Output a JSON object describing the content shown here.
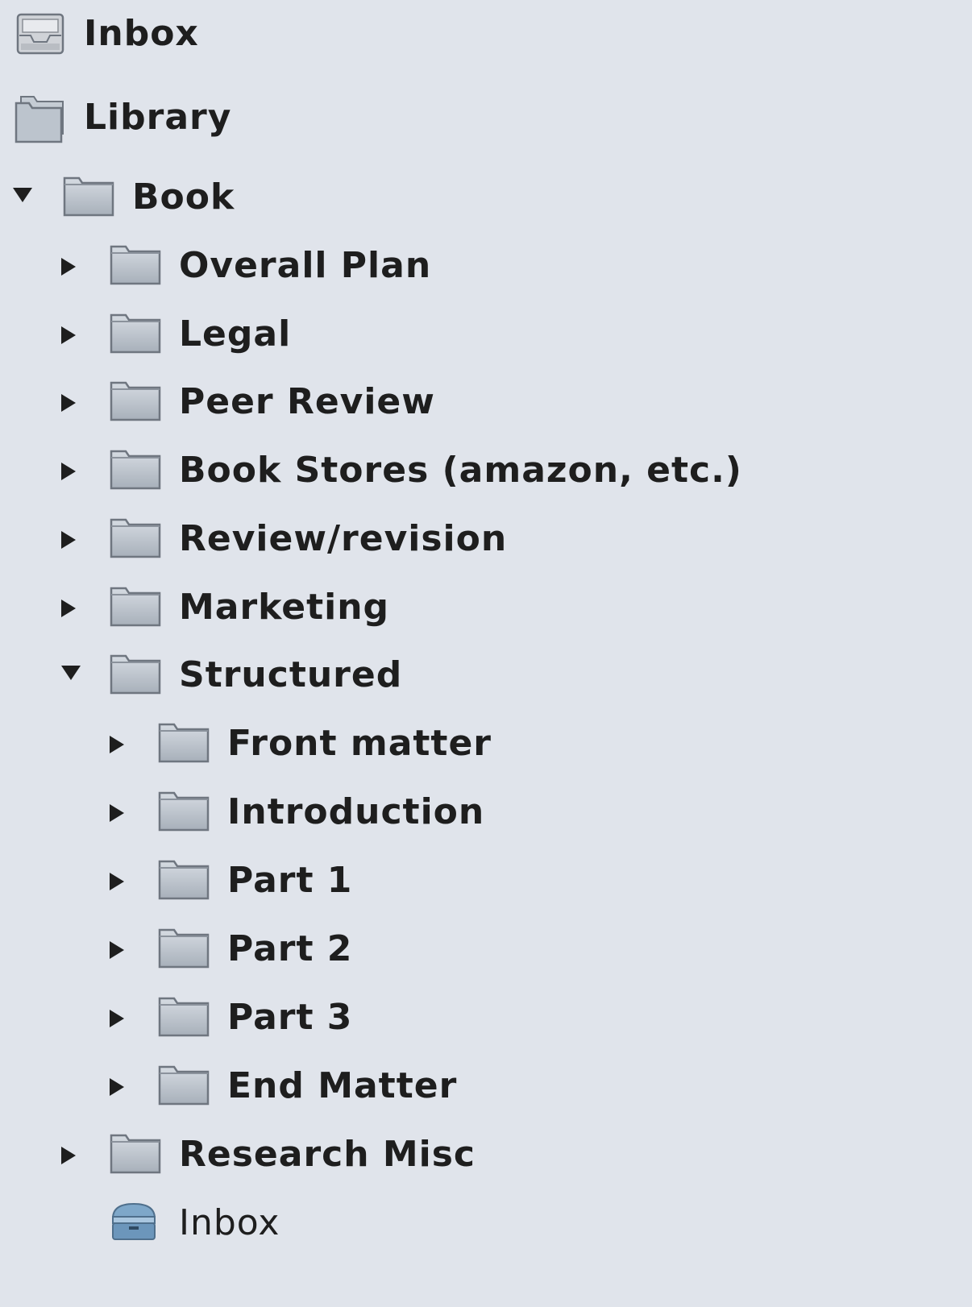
{
  "tree": {
    "items": [
      {
        "label": "Inbox",
        "icon": "inbox-tray-icon",
        "level": 0,
        "expander": "none"
      },
      {
        "label": "Library",
        "icon": "library-folders-icon",
        "level": 0,
        "expander": "none"
      },
      {
        "label": "Book",
        "icon": "folder-icon",
        "level": 1,
        "expander": "expanded"
      },
      {
        "label": "Overall Plan",
        "icon": "folder-icon",
        "level": 2,
        "expander": "collapsed"
      },
      {
        "label": "Legal",
        "icon": "folder-icon",
        "level": 2,
        "expander": "collapsed"
      },
      {
        "label": "Peer Review",
        "icon": "folder-icon",
        "level": 2,
        "expander": "collapsed"
      },
      {
        "label": "Book Stores (amazon, etc.)",
        "icon": "folder-icon",
        "level": 2,
        "expander": "collapsed"
      },
      {
        "label": "Review/revision",
        "icon": "folder-icon",
        "level": 2,
        "expander": "collapsed"
      },
      {
        "label": "Marketing",
        "icon": "folder-icon",
        "level": 2,
        "expander": "collapsed"
      },
      {
        "label": "Structured",
        "icon": "folder-icon",
        "level": 2,
        "expander": "expanded"
      },
      {
        "label": "Front matter",
        "icon": "folder-icon",
        "level": 3,
        "expander": "collapsed"
      },
      {
        "label": "Introduction",
        "icon": "folder-icon",
        "level": 3,
        "expander": "collapsed"
      },
      {
        "label": "Part 1",
        "icon": "folder-icon",
        "level": 3,
        "expander": "collapsed"
      },
      {
        "label": "Part 2",
        "icon": "folder-icon",
        "level": 3,
        "expander": "collapsed"
      },
      {
        "label": "Part 3",
        "icon": "folder-icon",
        "level": 3,
        "expander": "collapsed"
      },
      {
        "label": "End Matter",
        "icon": "folder-icon",
        "level": 3,
        "expander": "collapsed"
      },
      {
        "label": "Research Misc",
        "icon": "folder-icon",
        "level": 2,
        "expander": "collapsed"
      },
      {
        "label": "Inbox",
        "icon": "inbox-box-icon",
        "level": 2,
        "expander": "none"
      }
    ]
  }
}
